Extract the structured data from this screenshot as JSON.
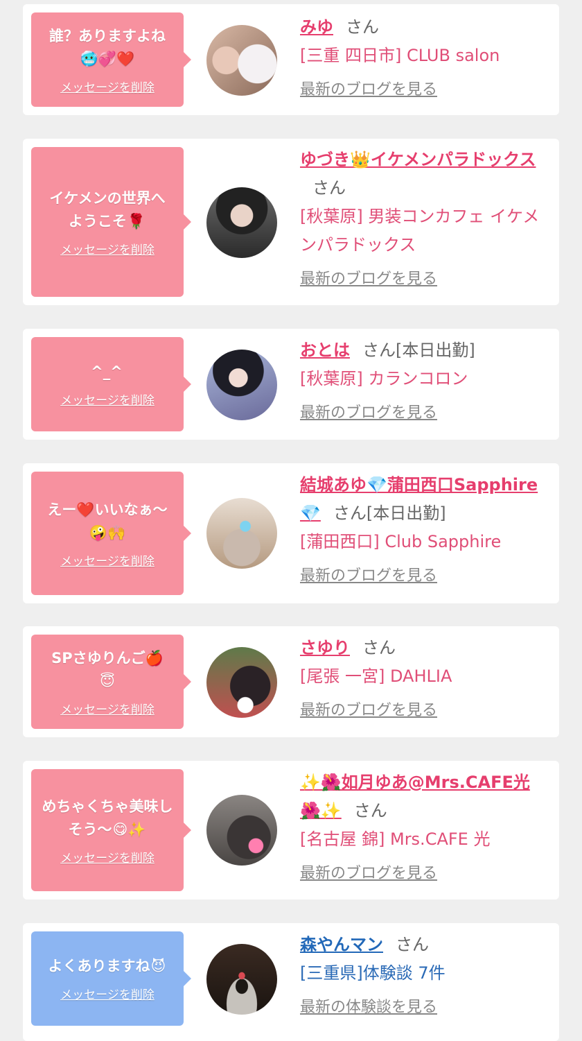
{
  "delete_label": "メッセージを削除",
  "colors": {
    "pink_bubble": "#f7919f",
    "blue_bubble": "#8cb5f2",
    "pink_name": "#e63e6d",
    "blue_name": "#2268b8"
  },
  "cards": [
    {
      "message": "誰？ありますよね",
      "message_emojis": "🥶💞❤️",
      "name": "みゆ",
      "suffix": "さん",
      "shop": "[三重 四日市] CLUB salon",
      "blog_link": "最新のブログを見る"
    },
    {
      "message": "イケメンの世界へようこそ",
      "message_emojis": "🌹",
      "name": "ゆづき👑イケメンパラドックス",
      "suffix": "さん",
      "shop": "[秋葉原] 男装コンカフェ イケメンパラドックス",
      "blog_link": "最新のブログを見る"
    },
    {
      "message": "^_^",
      "message_emojis": "",
      "name": "おとは",
      "suffix": "さん[本日出勤]",
      "shop": "[秋葉原] カランコロン",
      "blog_link": "最新のブログを見る"
    },
    {
      "message": "えー❤️いいなぁ〜",
      "message_emojis": "🤪🙌",
      "name": "結城あゆ💎蒲田西口Sapphire💎",
      "suffix": "さん[本日出勤]",
      "shop": "[蒲田西口] Club Sapphire",
      "blog_link": "最新のブログを見る"
    },
    {
      "message": "SPさゆりんご🍎",
      "message_emojis": "😇",
      "name": "さゆり",
      "suffix": "さん",
      "shop": "[尾張 一宮] DAHLIA",
      "blog_link": "最新のブログを見る"
    },
    {
      "message": "めちゃくちゃ美味しそう〜",
      "message_emojis": "😋✨",
      "name": "✨🌺如月ゆあ@Mrs.CAFE光🌺✨",
      "suffix": "さん",
      "shop": "[名古屋 錦] Mrs.CAFE 光",
      "blog_link": "最新のブログを見る"
    },
    {
      "message": "よくありますね",
      "message_emojis": "😈",
      "name": "森やんマン",
      "suffix": "さん",
      "shop": "[三重県]体験談 7件",
      "blog_link": "最新の体験談を見る"
    }
  ]
}
